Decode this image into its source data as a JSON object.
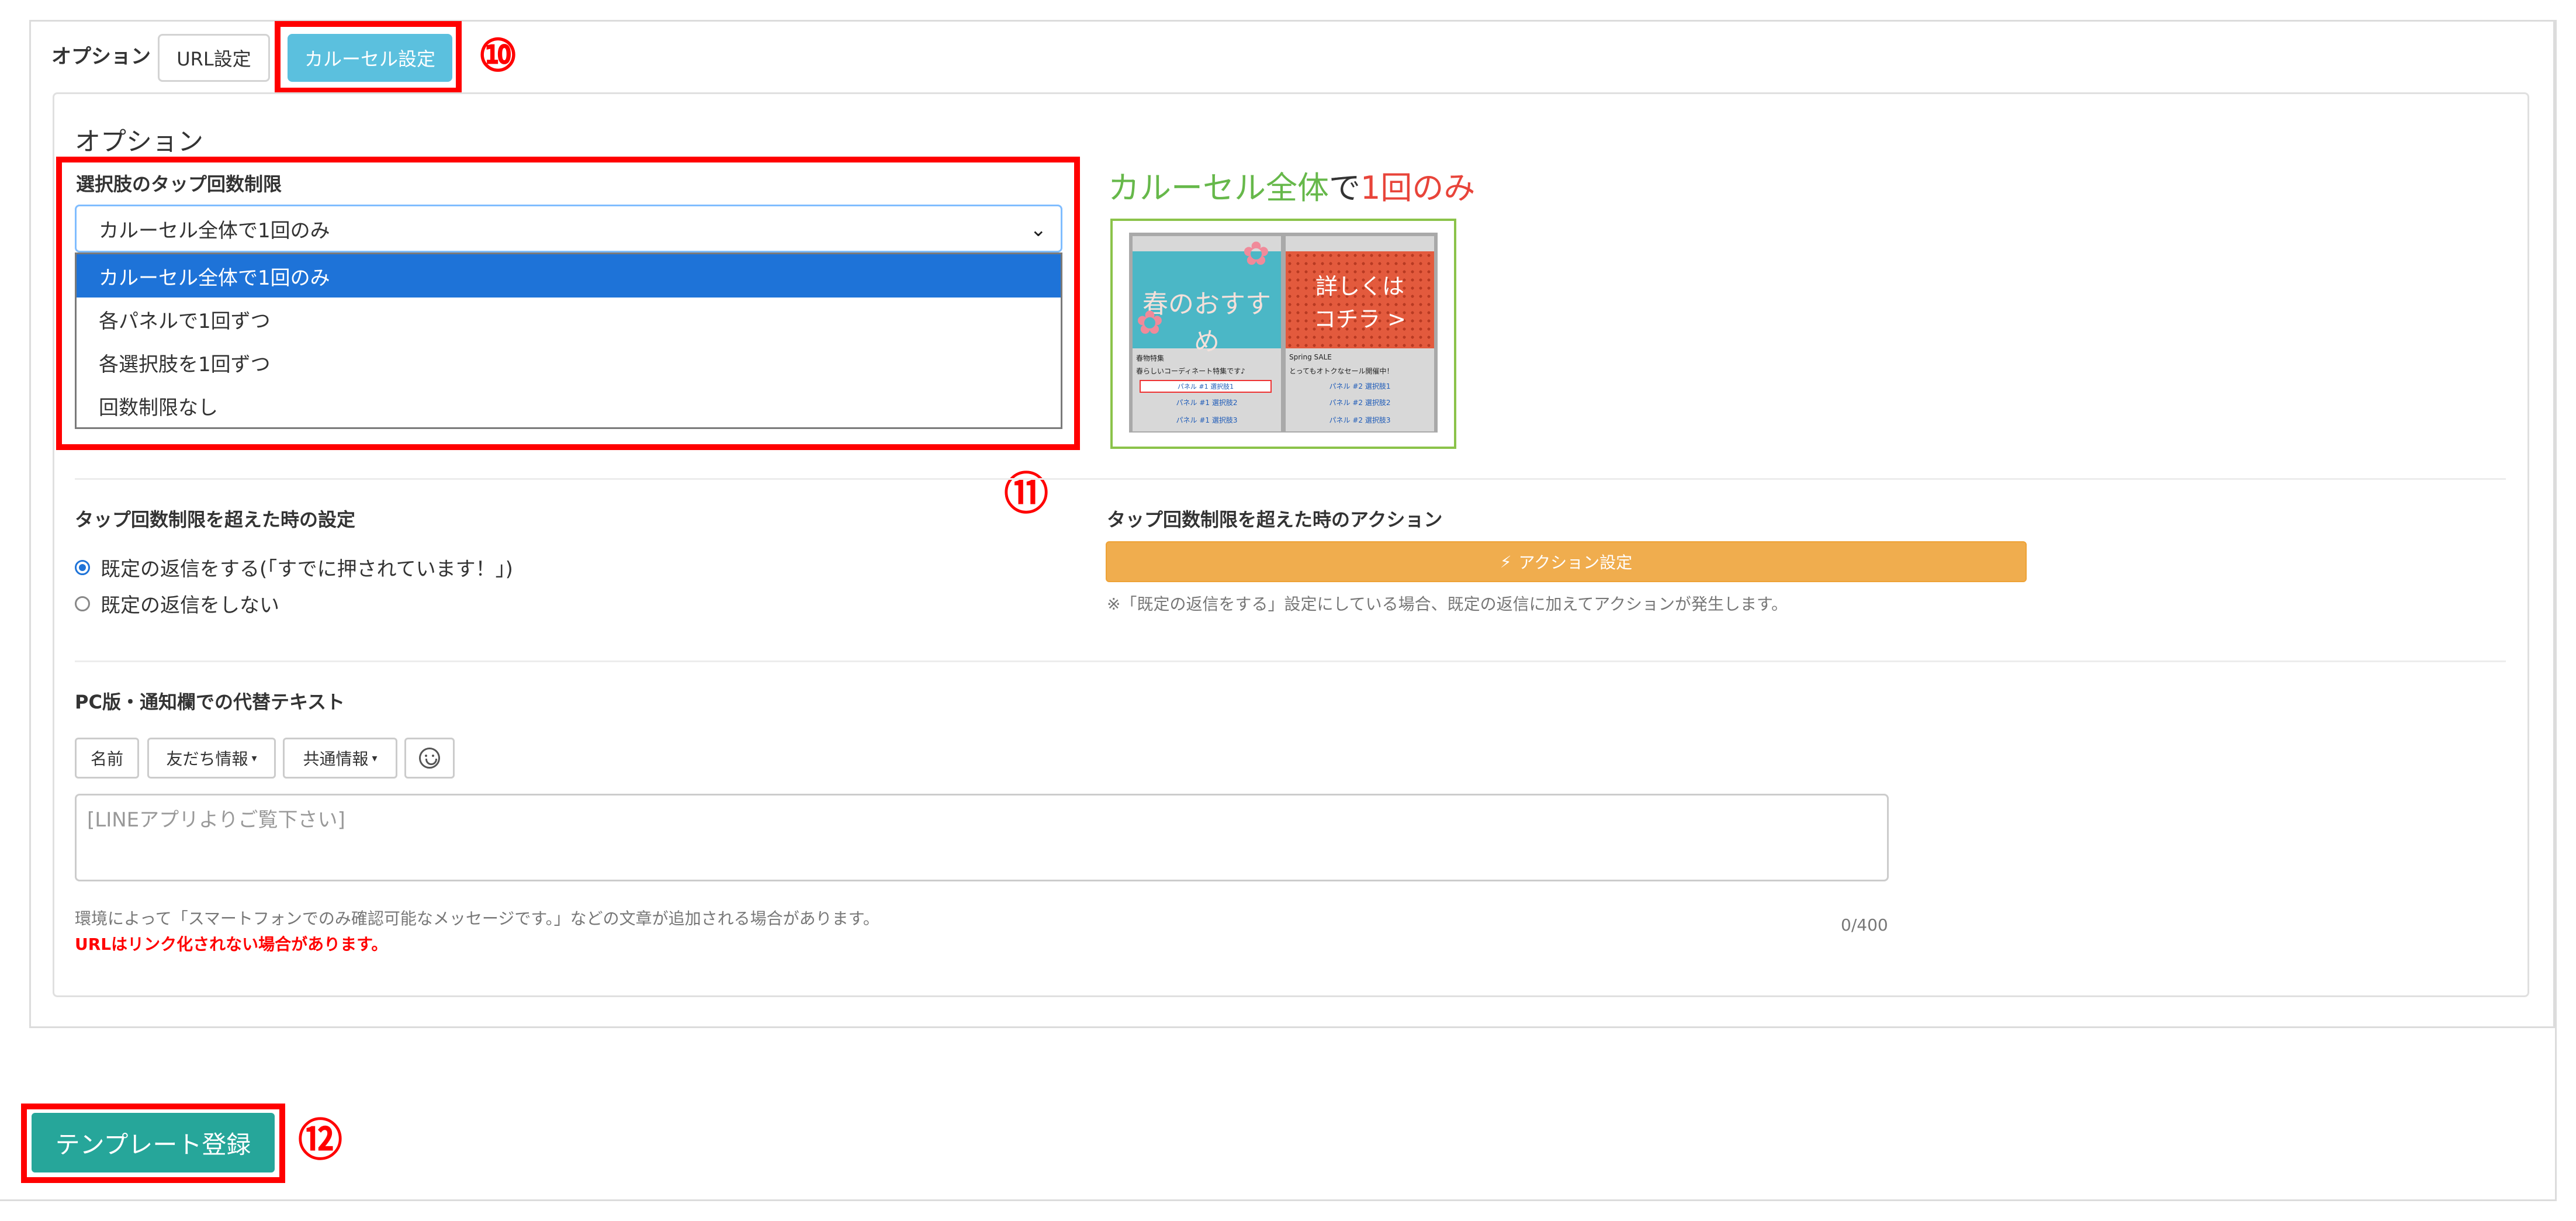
{
  "options_bar": {
    "label": "オプション",
    "tabs": [
      {
        "label": "URL設定",
        "active": false
      },
      {
        "label": "カルーセル設定",
        "active": true
      }
    ]
  },
  "annotations": {
    "n10": "⑩",
    "n11": "⑪",
    "n12": "⑫",
    "color": "#ff0000"
  },
  "panel": {
    "title": "オプション",
    "tap_limit": {
      "label": "選択肢のタップ回数制限",
      "selected": "カルーセル全体で1回のみ",
      "options": [
        "カルーセル全体で1回のみ",
        "各パネルで1回ずつ",
        "各選択肢を1回ずつ",
        "回数制限なし"
      ]
    },
    "preview": {
      "title_part1": "カルーセル全体",
      "title_part2": "で",
      "title_part3": "1回のみ",
      "panel_a": {
        "image_text": "春のおすすめ",
        "title": "春物特集",
        "desc": "春らしいコーディネート特集です♪",
        "buttons": [
          "パネル #1 選択肢1",
          "パネル #1 選択肢2",
          "パネル #1 選択肢3"
        ]
      },
      "panel_b": {
        "image_text_line1": "詳しくは",
        "image_text_line2": "コチラ >",
        "title": "Spring SALE",
        "desc": "とってもオトクなセール開催中！",
        "buttons": [
          "パネル #2 選択肢1",
          "パネル #2 選択肢2",
          "パネル #2 選択肢3"
        ]
      }
    },
    "over_limit": {
      "label": "タップ回数制限を超えた時の設定",
      "radios": [
        {
          "label": "既定の返信をする(「すでに押されています！」)",
          "checked": true
        },
        {
          "label": "既定の返信をしない",
          "checked": false
        }
      ]
    },
    "action": {
      "label": "タップ回数制限を超えた時のアクション",
      "button": "アクション設定",
      "note": "※「既定の返信をする」設定にしている場合、既定の返信に加えてアクションが発生します。"
    },
    "alt_text": {
      "label": "PC版・通知欄での代替テキスト",
      "toolbar": {
        "name": "名前",
        "friend": "友だち情報",
        "common": "共通情報"
      },
      "placeholder": "[LINEアプリよりご覧下さい]",
      "help": "環境によって「スマートフォンでのみ確認可能なメッセージです。」などの文章が追加される場合があります。",
      "warning": "URLはリンク化されない場合があります。",
      "counter": "0/400"
    }
  },
  "register_button": "テンプレート登録",
  "colors": {
    "accent_blue": "#5bc0de",
    "select_highlight": "#1e73d8",
    "action_orange": "#f0ad4e",
    "register_green": "#26a69a"
  }
}
